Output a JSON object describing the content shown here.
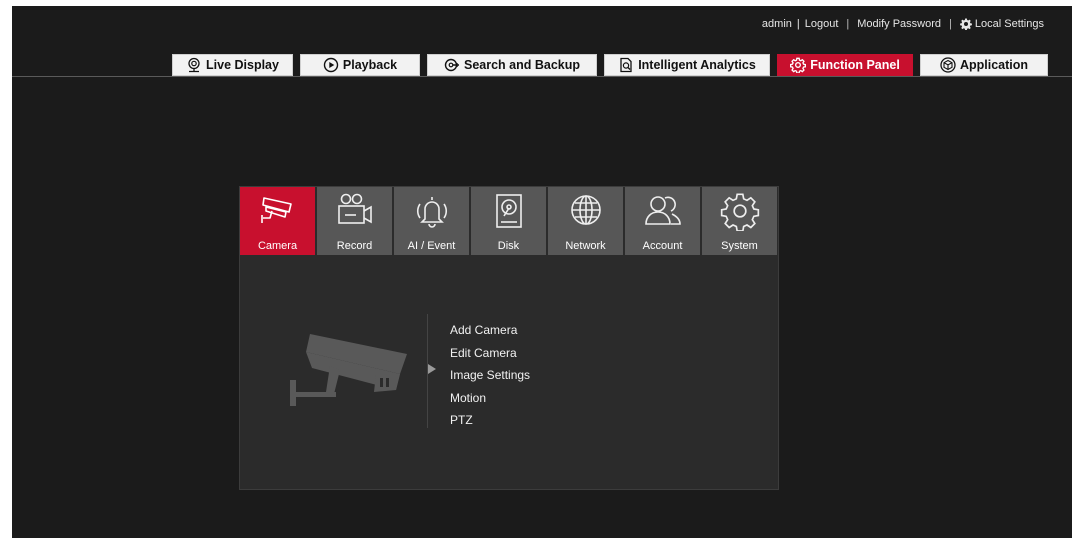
{
  "userbar": {
    "user": "admin",
    "logout": "Logout",
    "modify_password": "Modify Password",
    "local_settings": "Local Settings",
    "sep": "|"
  },
  "nav": {
    "tabs": [
      {
        "label": "Live Display",
        "icon": "webcam-icon",
        "active": false
      },
      {
        "label": "Playback",
        "icon": "play-circle-icon",
        "active": false
      },
      {
        "label": "Search and Backup",
        "icon": "search-backup-icon",
        "active": false
      },
      {
        "label": "Intelligent Analytics",
        "icon": "analytics-icon",
        "active": false
      },
      {
        "label": "Function Panel",
        "icon": "gear-icon",
        "active": true
      },
      {
        "label": "Application",
        "icon": "cube-icon",
        "active": false
      }
    ]
  },
  "panel": {
    "categories": [
      {
        "label": "Camera",
        "icon": "camera-icon",
        "active": true
      },
      {
        "label": "Record",
        "icon": "record-icon",
        "active": false
      },
      {
        "label": "AI / Event",
        "icon": "bell-icon",
        "active": false
      },
      {
        "label": "Disk",
        "icon": "disk-icon",
        "active": false
      },
      {
        "label": "Network",
        "icon": "globe-icon",
        "active": false
      },
      {
        "label": "Account",
        "icon": "users-icon",
        "active": false
      },
      {
        "label": "System",
        "icon": "gear-icon",
        "active": false
      }
    ],
    "submenu": [
      "Add Camera",
      "Edit Camera",
      "Image Settings",
      "Motion",
      "PTZ"
    ],
    "selected_submenu": "Image Settings"
  },
  "colors": {
    "accent": "#c8102e",
    "background": "#1b1b1b",
    "panel": "#2b2b2b",
    "category": "#575757"
  }
}
